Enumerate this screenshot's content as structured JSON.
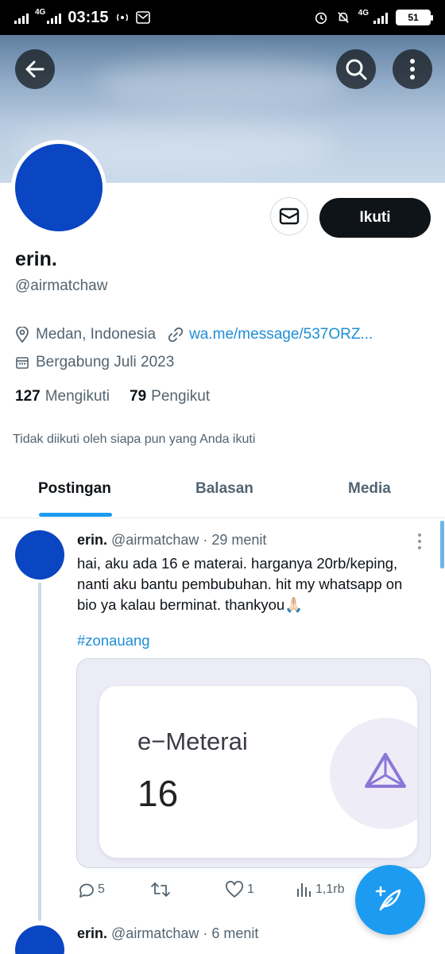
{
  "status_bar": {
    "network": "4G",
    "time": "03:15",
    "network_right": "4G",
    "battery": "51"
  },
  "profile": {
    "name": "erin.",
    "handle": "@airmatchaw",
    "location": "Medan, Indonesia",
    "link": "wa.me/message/537ORZ...",
    "joined": "Bergabung Juli 2023",
    "following_count": "127",
    "following_label": "Mengikuti",
    "followers_count": "79",
    "followers_label": "Pengikut",
    "followed_note": "Tidak diikuti oleh siapa pun yang Anda ikuti",
    "avatar_color": "#0a45c2"
  },
  "actions": {
    "follow_label": "Ikuti"
  },
  "tabs": [
    {
      "label": "Postingan",
      "active": true
    },
    {
      "label": "Balasan",
      "active": false
    },
    {
      "label": "Media",
      "active": false
    }
  ],
  "tweet": {
    "name": "erin.",
    "handle": "@airmatchaw",
    "time": "· 29 menit",
    "lines": [
      "hai, aku ada 16 e materai. harganya 20rb/keping,",
      "nanti aku bantu pembubuhan. hit my whatsapp on",
      "bio ya kalau berminat. thankyou🙏🏻"
    ],
    "hashtag": "#zonauang",
    "media": {
      "title": "e−Meterai",
      "number": "16"
    },
    "replies": "5",
    "reposts": "",
    "likes": "1",
    "views": "1,1rb"
  },
  "tweet2": {
    "name": "erin.",
    "handle": "@airmatchaw",
    "time": "· 6 menit"
  },
  "colors": {
    "accent": "#1d9bf0",
    "text": "#0f1419",
    "muted": "#536471"
  }
}
